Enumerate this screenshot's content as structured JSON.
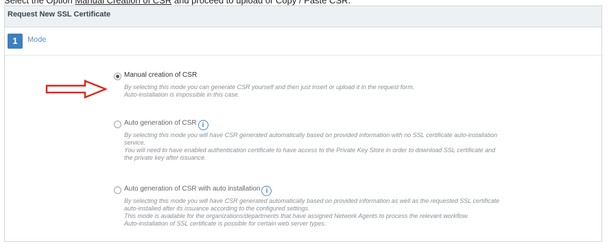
{
  "instruction": {
    "prefix": "Select the Option ",
    "link": "Manual Creation of CSR",
    "suffix": " and proceed to upload or Copy / Paste CSR."
  },
  "panel": {
    "title": "Request New SSL Certificate"
  },
  "step": {
    "number": "1",
    "label": "Mode"
  },
  "colors": {
    "step_badge": "#3d7fbf",
    "arrow": "#e0271e",
    "info_icon": "#4a87c8"
  },
  "options": [
    {
      "title": "Manual creation of CSR",
      "checked": true,
      "has_info": false,
      "desc": [
        "By selecting this mode you can generate CSR yourself and then just insert or upload it in the request form.",
        "Auto-installation is impossible in this case."
      ]
    },
    {
      "title": "Auto generation of CSR",
      "checked": false,
      "has_info": true,
      "desc": [
        "By selecting this mode you will have CSR generated automatically based on provided information with no SSL certificate auto-installation",
        "service.",
        "You will need to have enabled authentication certificate to have access to the Private Key Store in order to download SSL certificate and",
        "the private key after issuance."
      ]
    },
    {
      "title": "Auto generation of CSR with auto installation",
      "checked": false,
      "has_info": true,
      "desc": [
        "By selecting this mode you will have CSR generated automatically based on provided information as well as the requested SSL certificate",
        "auto-installed after its issuance according to the configured settings.",
        "This mode is available for the organizations/departments that have assigned Network Agents to process the relevant workflow.",
        "Auto-installation of SSL certificate is possible for certain web server types."
      ]
    }
  ]
}
